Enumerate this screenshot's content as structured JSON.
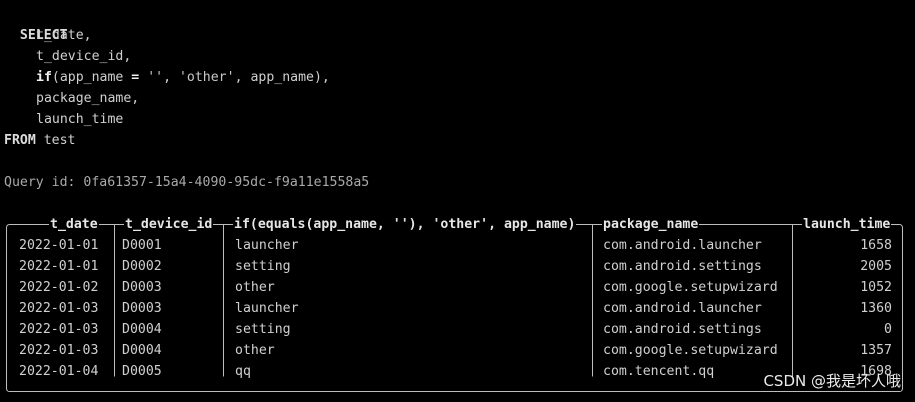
{
  "query": {
    "select_kw": "SELECT",
    "col1": "t_date,",
    "col2": "t_device_id,",
    "col3_fn": "if",
    "col3_open": "(app_name ",
    "col3_eq": "=",
    "col3_sp": " ",
    "col3_empty": "''",
    "col3_comma": ", ",
    "col3_other": "'other'",
    "col3_rest": ", app_name),",
    "col4": "package_name,",
    "col5": "launch_time",
    "from_kw": "FROM",
    "table": " test",
    "query_id_label": "Query id: ",
    "query_id": "0fa61357-15a4-4090-95dc-f9a11e1558a5"
  },
  "result": {
    "headers": [
      "t_date",
      "t_device_id",
      "if(equals(app_name, ''), 'other', app_name)",
      "package_name",
      "launch_time"
    ],
    "rows": [
      [
        "2022-01-01",
        "D0001",
        "launcher",
        "com.android.launcher",
        "1658"
      ],
      [
        "2022-01-01",
        "D0002",
        "setting",
        "com.android.settings",
        "2005"
      ],
      [
        "2022-01-02",
        "D0003",
        "other",
        "com.google.setupwizard",
        "1052"
      ],
      [
        "2022-01-03",
        "D0003",
        "launcher",
        "com.android.launcher",
        "1360"
      ],
      [
        "2022-01-03",
        "D0004",
        "setting",
        "com.android.settings",
        "0"
      ],
      [
        "2022-01-03",
        "D0004",
        "other",
        "com.google.setupwizard",
        "1357"
      ],
      [
        "2022-01-04",
        "D0005",
        "qq",
        "com.tencent.qq",
        "1698"
      ]
    ]
  },
  "watermark": "CSDN @我是坏人哦"
}
